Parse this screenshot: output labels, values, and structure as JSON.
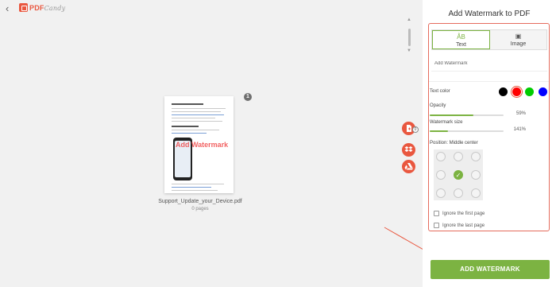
{
  "header": {
    "logo_main": "PDF",
    "logo_sub": "Candy"
  },
  "document": {
    "wm_preview": "Add Watermark",
    "page_badge": "1",
    "filename": "Support_Update_your_Device.pdf",
    "pages": "0 pages",
    "heading": "Update your iPhone or iPad"
  },
  "side_actions": {
    "drive_badge": "0"
  },
  "panel": {
    "title": "Add Watermark to PDF",
    "tabs": [
      {
        "label": "Text",
        "icon": "text-icon"
      },
      {
        "label": "Image",
        "icon": "image-icon"
      }
    ],
    "text_placeholder": "Add Watermark",
    "text_color_label": "Text color",
    "colors": [
      "#000000",
      "#ff0000",
      "#00cc00",
      "#0000ff"
    ],
    "selected_color": "#ff0000",
    "opacity_label": "Opacity",
    "opacity_value": "59%",
    "opacity_fraction": 0.59,
    "size_label": "Watermark size",
    "size_value": "141%",
    "size_fraction": 0.25,
    "position_label": "Position: Middle center",
    "ignore_first": "Ignore the first page",
    "ignore_last": "Ignore the last page"
  },
  "action": {
    "add_label": "ADD WATERMARK"
  },
  "theme": {
    "brand": "#e9573f",
    "accent": "#7cb342"
  }
}
